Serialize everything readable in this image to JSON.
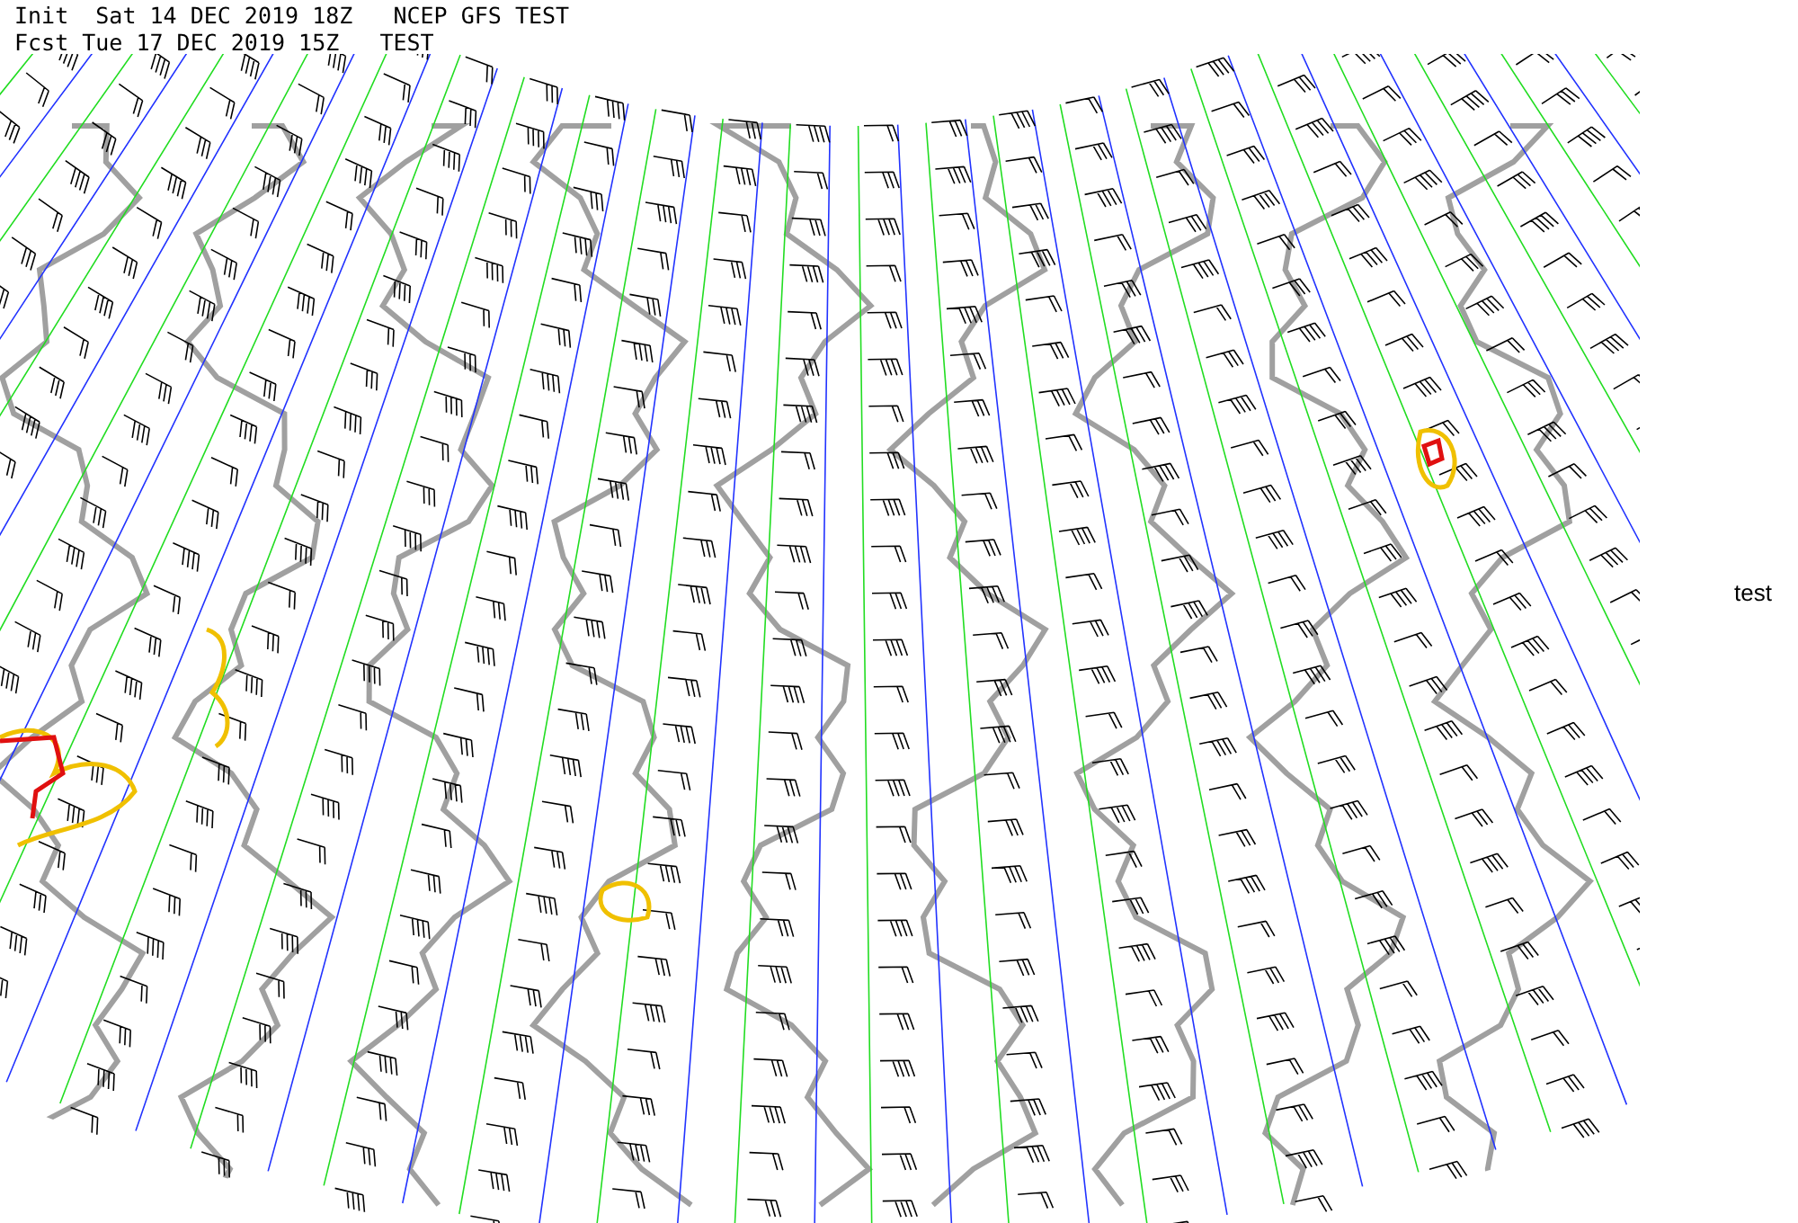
{
  "header": {
    "init_line": "Init  Sat 14 DEC 2019 18Z   NCEP GFS TEST",
    "forecast_line": "Fcst Tue 17 DEC 2019 15Z   TEST"
  },
  "side_label": "test"
}
